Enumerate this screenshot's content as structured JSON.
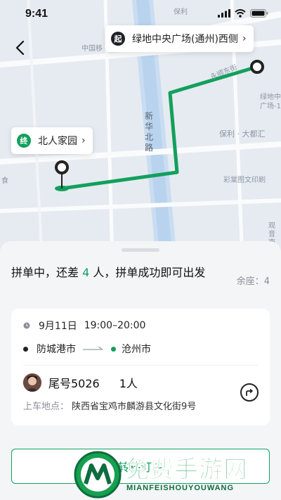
{
  "status_bar": {
    "time": "9:41"
  },
  "map": {
    "start_tag": "起",
    "start_place": "绿地中央广场(通州)西侧",
    "end_tag": "终",
    "end_place": "北人家园",
    "labels": {
      "china_mobile": "中国移",
      "baoli": "保利",
      "yongshun": "永顺东街",
      "xinhua_north": "新华北路",
      "greenland_plaza": "绿地中广场-1",
      "baoli_duhui": "保利 · 大都汇",
      "caitang_print": "彩棠图文印刷",
      "shi": "食",
      "guan_nan": "观音南侨"
    },
    "route_color": "#12a05c"
  },
  "sheet": {
    "headline_prefix": "拼单中，还差 ",
    "headline_count": "4",
    "headline_suffix": " 人，拼单成功即可出发",
    "seats_label": "余座：4",
    "card": {
      "date": "9月11日",
      "time_range": "19:00–20:00",
      "from_city": "防城港市",
      "to_city": "沧州市",
      "tail_number": "尾号5026",
      "passengers": "1人",
      "pickup_label": "上车地点：",
      "pickup_address": "陕西省宝鸡市麟游县文化街9号"
    },
    "transfer_button": "转移订单"
  },
  "watermark": {
    "title": "免费手游网",
    "subtitle": "MIANFEISHOUYOUWANG"
  },
  "icons": {
    "back": "chevron-left-icon",
    "clock": "clock-icon",
    "route_arrow": "arrow-right-icon",
    "navigate": "navigation-icon"
  },
  "colors": {
    "accent": "#12a05c",
    "text": "#1a1a1a",
    "muted": "#8a8f98"
  }
}
